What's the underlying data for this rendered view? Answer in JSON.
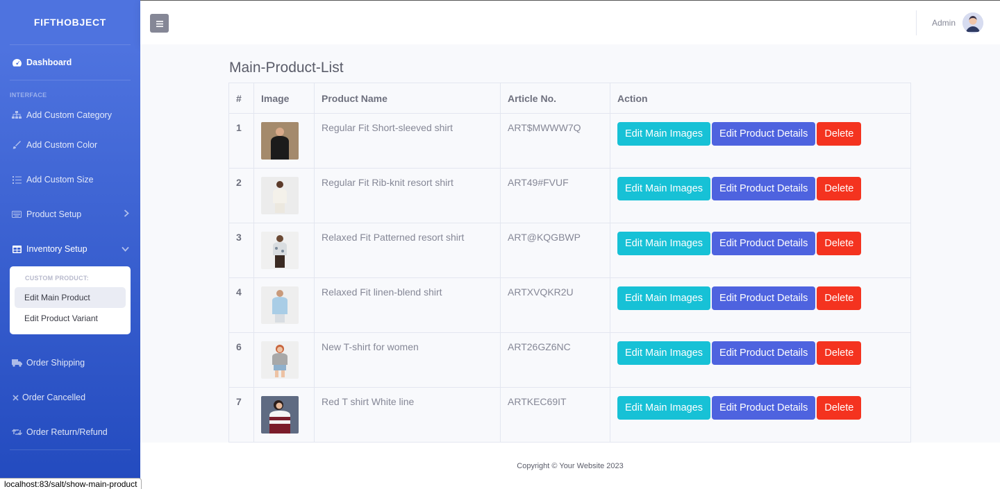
{
  "sidebar": {
    "brand": "FIFTHOBJECT",
    "dashboard": "Dashboard",
    "heading_interface": "INTERFACE",
    "items": [
      {
        "label": "Add Custom Category",
        "icon": "sitemap-icon"
      },
      {
        "label": "Add Custom Color",
        "icon": "brush-icon"
      },
      {
        "label": "Add Custom Size",
        "icon": "list-icon"
      },
      {
        "label": "Product Setup",
        "icon": "keyboard-icon"
      },
      {
        "label": "Inventory Setup",
        "icon": "table-icon"
      }
    ],
    "collapse": {
      "header": "CUSTOM PRODUCT:",
      "items": [
        "Edit Main Product",
        "Edit Product Variant"
      ]
    },
    "bottom_items": [
      {
        "label": "Order Shipping",
        "icon": "truck-icon"
      },
      {
        "label": "Order Cancelled",
        "icon": "times-icon"
      },
      {
        "label": "Order Return/Refund",
        "icon": "retweet-icon"
      }
    ]
  },
  "topbar": {
    "user_name": "Admin"
  },
  "main": {
    "title": "Main-Product-List",
    "columns": [
      "#",
      "Image",
      "Product Name",
      "Article No.",
      "Action"
    ],
    "actions": {
      "edit_images": "Edit Main Images",
      "edit_details": "Edit Product Details",
      "delete": "Delete"
    },
    "rows": [
      {
        "num": "1",
        "name": "Regular Fit Short-sleeved shirt",
        "article": "ART$MWWW7Q"
      },
      {
        "num": "2",
        "name": "Regular Fit Rib-knit resort shirt",
        "article": "ART49#FVUF"
      },
      {
        "num": "3",
        "name": "Relaxed Fit Patterned resort shirt",
        "article": "ART@KQGBWP"
      },
      {
        "num": "4",
        "name": "Relaxed Fit linen-blend shirt",
        "article": "ARTXVQKR2U"
      },
      {
        "num": "6",
        "name": "New T-shirt for women",
        "article": "ART26GZ6NC"
      },
      {
        "num": "7",
        "name": "Red T shirt White line",
        "article": "ARTKEC69IT"
      }
    ]
  },
  "footer": {
    "text": "Copyright © Your Website 2023"
  },
  "statusbar": {
    "url": "localhost:83/salt/show-main-product"
  },
  "colors": {
    "primary": "#4e73df",
    "info": "#17c1d6",
    "danger": "#f4331f"
  }
}
